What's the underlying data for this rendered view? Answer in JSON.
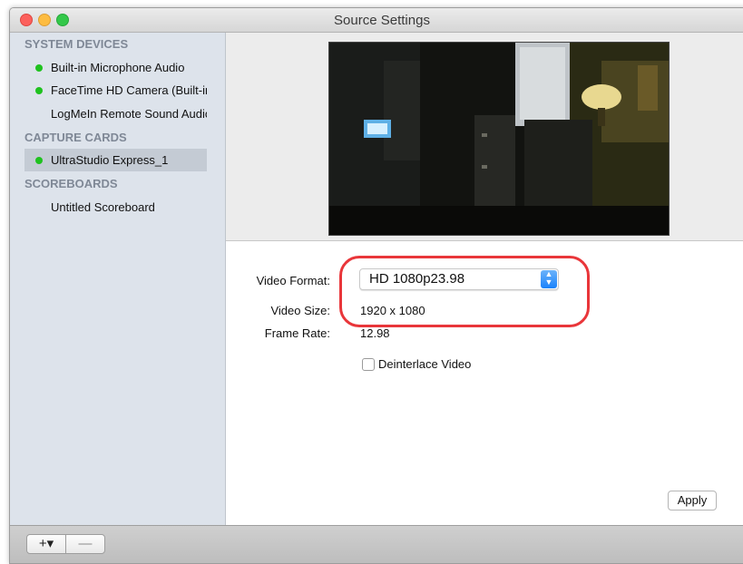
{
  "window": {
    "title": "Source Settings"
  },
  "sidebar": {
    "sections": [
      {
        "header": "SYSTEM DEVICES",
        "items": [
          {
            "label": "Built-in Microphone Audio",
            "active": true
          },
          {
            "label": "FaceTime HD Camera (Built-in)",
            "active": true
          },
          {
            "label": "LogMeIn Remote Sound Audio",
            "active": false
          }
        ]
      },
      {
        "header": "CAPTURE CARDS",
        "items": [
          {
            "label": "UltraStudio Express_1",
            "active": true,
            "selected": true
          }
        ]
      },
      {
        "header": "SCOREBOARDS",
        "items": [
          {
            "label": "Untitled Scoreboard",
            "active": false
          }
        ]
      }
    ]
  },
  "settings": {
    "video_format_label": "Video Format:",
    "video_format_value": "HD 1080p23.98",
    "video_size_label": "Video Size:",
    "video_size_value": "1920 x 1080",
    "frame_rate_label": "Frame Rate:",
    "frame_rate_value": "12.98",
    "deinterlace_label": "Deinterlace Video",
    "deinterlace_checked": false,
    "apply_label": "Apply"
  },
  "bottom_bar": {
    "add_label": "+▾",
    "remove_label": "—"
  },
  "colors": {
    "status_dot": "#1fc21f",
    "highlight": "#e9363a",
    "select_arrow": "#1a82fb"
  }
}
